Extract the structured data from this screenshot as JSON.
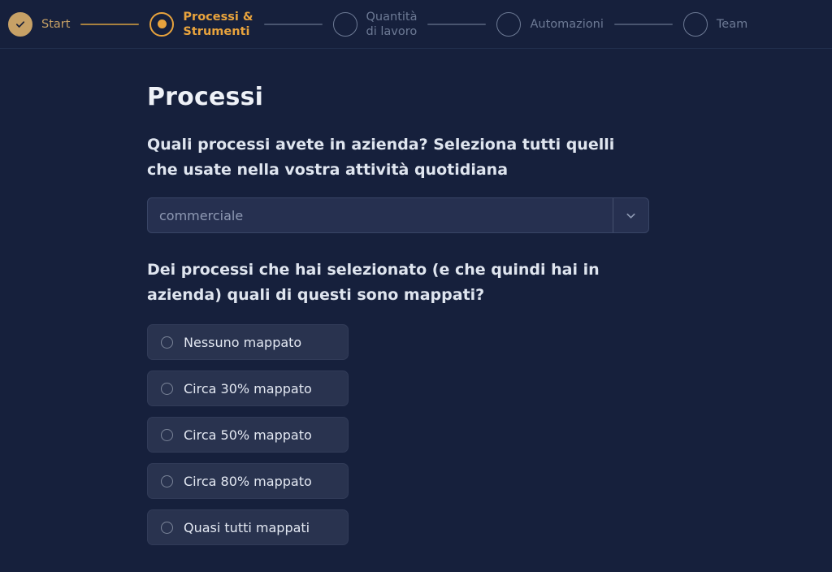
{
  "stepper": {
    "steps": [
      {
        "label": "Start",
        "state": "done",
        "icon": "check-icon"
      },
      {
        "label": "Processi &\nStrumenti",
        "state": "active",
        "icon": "current-step-dot-icon"
      },
      {
        "label": "Quantità\ndi lavoro",
        "state": "todo",
        "icon": "empty-circle-icon"
      },
      {
        "label": "Automazioni",
        "state": "todo",
        "icon": "empty-circle-icon"
      },
      {
        "label": "Team",
        "state": "todo",
        "icon": "empty-circle-icon"
      }
    ],
    "connectors": [
      "gold",
      "plain",
      "plain",
      "plain"
    ]
  },
  "main": {
    "title": "Processi",
    "question_one": "Quali processi avete in azienda? Seleziona tutti quelli che usate nella vostra attività quotidiana",
    "processes_select": {
      "value": "commerciale",
      "placeholder": "commerciale",
      "arrow_icon": "chevron-down-icon"
    },
    "question_two": "Dei processi che hai selezionato (e che quindi hai in azienda) quali di questi sono mappati?",
    "mapping_options": [
      {
        "label": "Nessuno mappato",
        "selected": false
      },
      {
        "label": "Circa 30% mappato",
        "selected": false
      },
      {
        "label": "Circa 50% mappato",
        "selected": false
      },
      {
        "label": "Circa 80% mappato",
        "selected": false
      },
      {
        "label": "Quasi tutti mappati",
        "selected": false
      }
    ]
  },
  "colors": {
    "background": "#16203c",
    "accent_active": "#e8a33d",
    "accent_done": "#c7a166",
    "muted": "#6d7a95",
    "surface": "#29334f",
    "text_primary": "#e3e8f2"
  }
}
